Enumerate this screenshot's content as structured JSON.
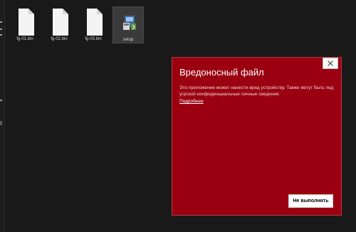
{
  "files": [
    {
      "name": "fg-01.bin",
      "icon": "document-icon"
    },
    {
      "name": "fg-02.bin",
      "icon": "document-icon"
    },
    {
      "name": "fg-03.bin",
      "icon": "document-icon"
    },
    {
      "name": "setup",
      "icon": "installer-icon",
      "selected": true
    }
  ],
  "dialog": {
    "title": "Вредоносный файл",
    "message": "Это приложение может нанести вред устройству. Также могут быть под угрозой конфиденциальные личные сведения.",
    "link": "Подробнее",
    "close_icon": "close-icon",
    "button_label": "Не выполнять",
    "background_color": "#9a0010"
  }
}
